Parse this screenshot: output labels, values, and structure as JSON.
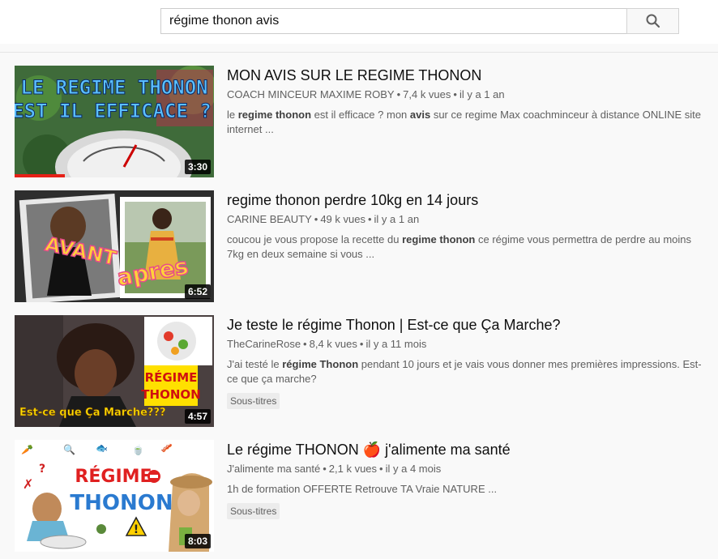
{
  "search": {
    "query": "régime thonon avis"
  },
  "results": [
    {
      "title": "MON AVIS SUR LE REGIME THONON",
      "channel": "COACH MINCEUR MAXIME ROBY",
      "views": "7,4 k vues",
      "age": "il y a 1 an",
      "desc": [
        "le ",
        "regime thonon",
        " est il efficace ? mon ",
        "avis",
        " sur ce regime Max coachminceur à distance ONLINE site internet ..."
      ],
      "duration": "3:30",
      "watched_fraction": 0.25,
      "thumb_text": [
        "LE REGIME THONON",
        "EST IL EFFICACE ?"
      ]
    },
    {
      "title": "regime thonon perdre 10kg en 14 jours",
      "channel": "CARINE BEAUTY",
      "views": "49 k vues",
      "age": "il y a 1 an",
      "desc": [
        "coucou je vous propose la recette du ",
        "regime thonon",
        " ce régime vous permettra de perdre au moins 7kg en deux semaine si vous ..."
      ],
      "duration": "6:52",
      "thumb_text": [
        "AVANT",
        "apres"
      ]
    },
    {
      "title": "Je teste le régime Thonon | Est-ce que Ça Marche?",
      "channel": "TheCarineRose",
      "views": "8,4 k vues",
      "age": "il y a 11 mois",
      "desc": [
        "J'ai testé le ",
        "régime Thonon",
        " pendant 10 jours et je vais vous donner mes premières impressions. Est-ce que ça marche?"
      ],
      "duration": "4:57",
      "badge": "Sous-titres",
      "thumb_text": [
        "RÉGIME",
        "THONON",
        "Est-ce que Ça Marche???"
      ]
    },
    {
      "title": "Le régime THONON 🍎 j'alimente ma santé",
      "channel": "J'alimente ma santé",
      "views": "2,1 k vues",
      "age": "il y a 4 mois",
      "desc": [
        "1h de formation OFFERTE Retrouve TA Vraie NATURE ..."
      ],
      "duration": "8:03",
      "badge": "Sous-titres",
      "thumb_text": [
        "RÉGIME",
        "THONON"
      ]
    }
  ],
  "icons": {
    "search": "search-icon"
  },
  "colors": {
    "progress": "#e62117",
    "background": "#f9f9f9"
  }
}
